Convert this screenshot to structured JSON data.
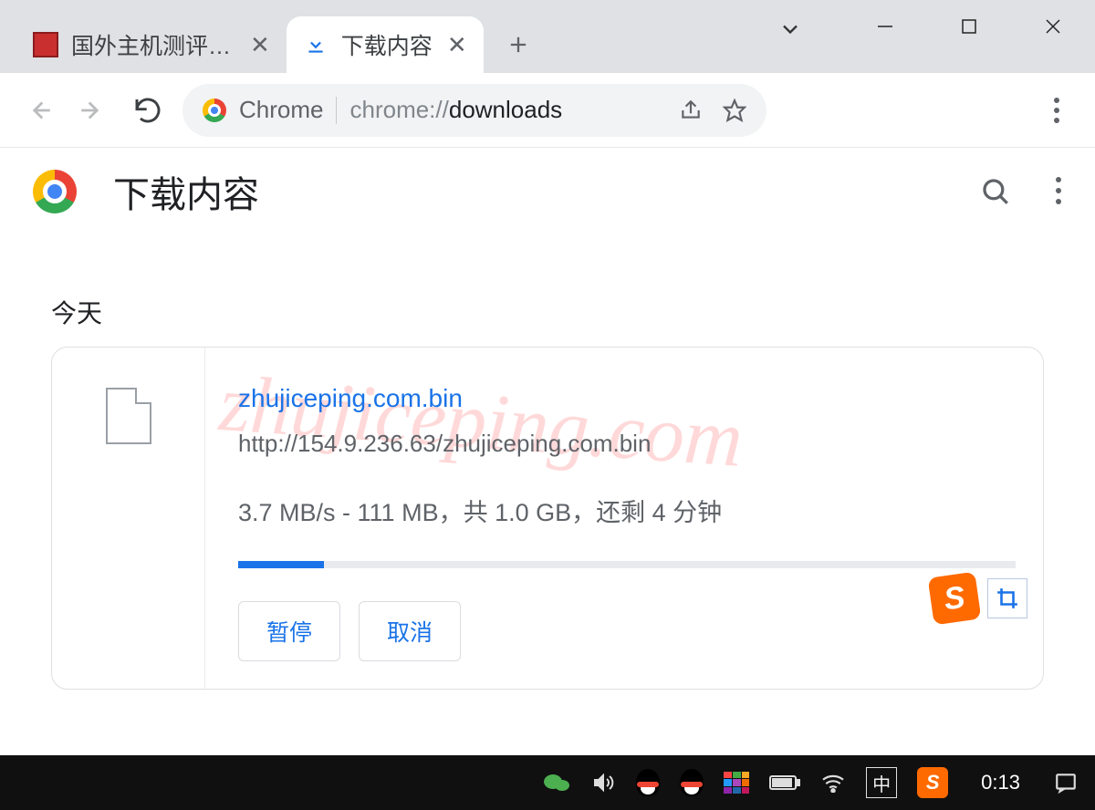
{
  "window": {
    "tabs": [
      {
        "label": "国外主机测评 - 国",
        "active": false
      },
      {
        "label": "下载内容",
        "active": true
      }
    ]
  },
  "address_bar": {
    "prefix": "Chrome",
    "url_gray1": "chrome://",
    "url_dark": "downloads",
    "url_gray2": ""
  },
  "page": {
    "title": "下载内容",
    "section_today": "今天"
  },
  "download": {
    "filename": "zhujiceping.com.bin",
    "source_url": "http://154.9.236.63/zhujiceping.com.bin",
    "progress_text": "3.7 MB/s - 111 MB，共 1.0 GB，还剩 4 分钟",
    "progress_percent": 11,
    "pause_label": "暂停",
    "cancel_label": "取消"
  },
  "watermark": "zhujiceping.com",
  "taskbar": {
    "ime": "中",
    "clock": "0:13"
  }
}
